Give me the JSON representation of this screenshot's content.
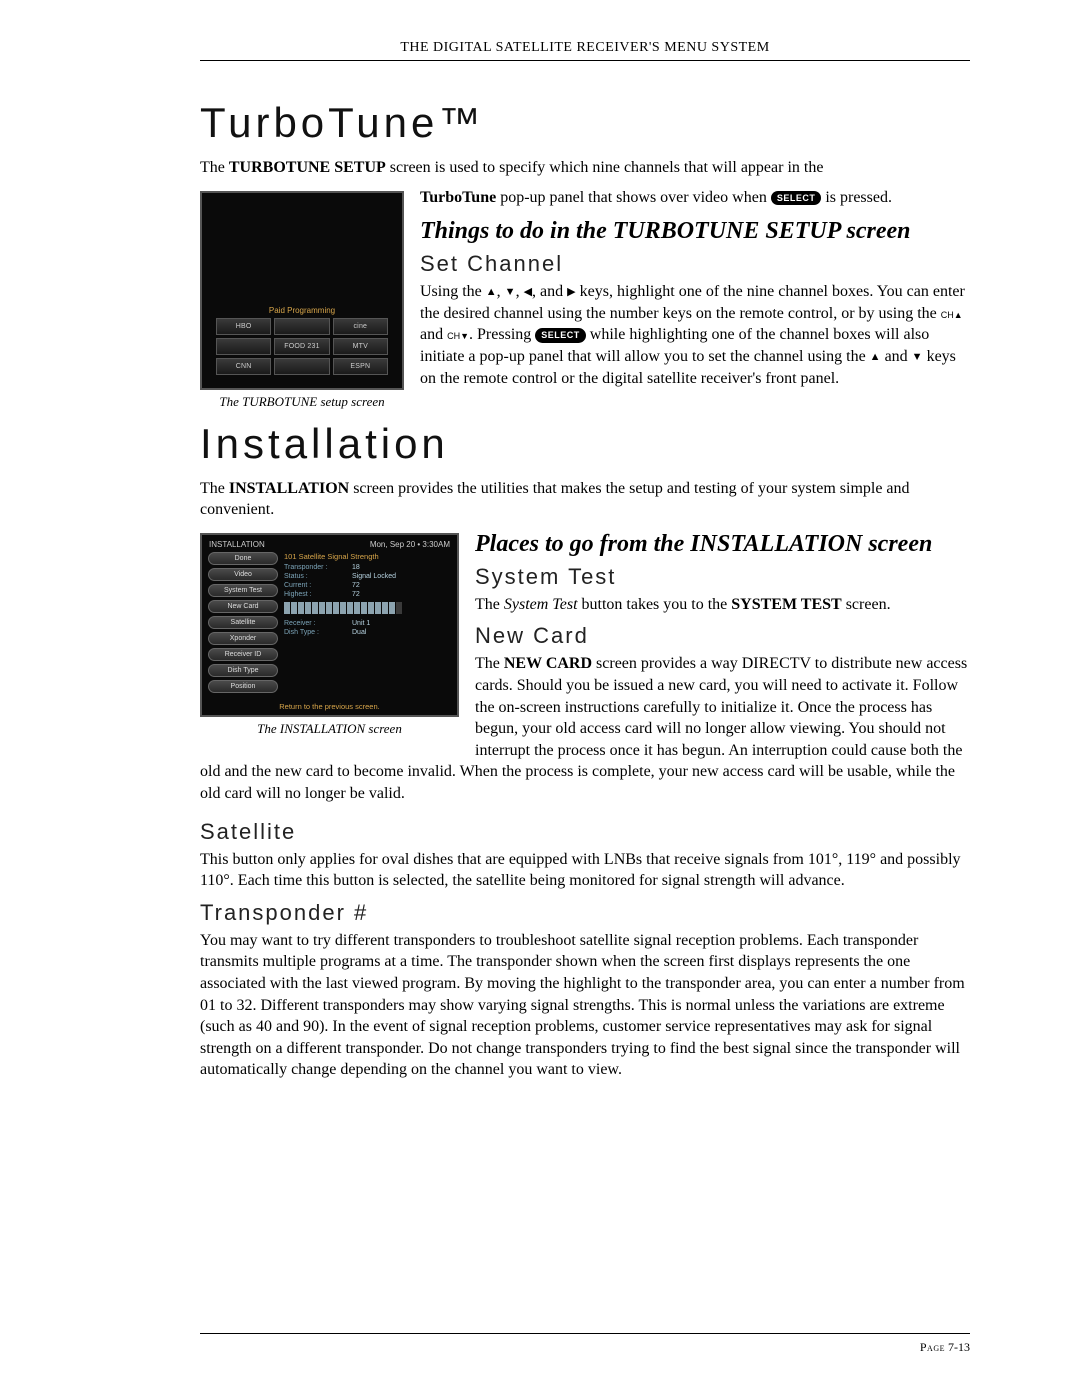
{
  "header": "THE DIGITAL SATELLITE RECEIVER'S MENU SYSTEM",
  "turbo": {
    "title": "TurboTune™",
    "intro_pre": "The ",
    "intro_bold1": "TURBOTUNE SETUP",
    "intro_mid": " screen is used to specify which nine channels that will appear in the ",
    "intro_bold2": "TurboTune",
    "intro_post1": " pop-up panel that shows over video when ",
    "select_label": "SELECT",
    "intro_post2": " is pressed.",
    "sub_h": "Things to do in the TURBOTUNE SETUP screen",
    "setch_h": "Set Channel",
    "setch_p1a": "Using the ",
    "setch_p1b": " keys, highlight one of the nine channel boxes. You can enter the desired channel using the number keys on the remote control, or by using the ",
    "setch_p1c": ". Pressing ",
    "setch_p1d": " while highlighting one of the channel boxes will also initiate a pop-up panel that will allow you to set the channel using the ",
    "setch_p1e": " keys on the remote control or the digital satellite receiver's front panel.",
    "and_word": " and ",
    "comma": ", ",
    "and_list": ", and ",
    "fig": {
      "caption": "The TURBOTUNE setup screen",
      "grid_title": "Paid Programming",
      "cells": [
        "HBO",
        "",
        "cine",
        "",
        "FOOD 231",
        "MTV",
        "CNN",
        "",
        "ESPN"
      ]
    }
  },
  "install": {
    "title": "Installation",
    "intro_pre": "The ",
    "intro_bold": "INSTALLATION",
    "intro_post": " screen provides the utilities that makes the setup and testing of your system simple and convenient.",
    "sub_h": "Places to go from the INSTALLATION screen",
    "systest_h": "System Test",
    "systest_p_pre": "The ",
    "systest_p_it": "System Test",
    "systest_p_mid": " button takes you to the ",
    "systest_p_bold": "SYSTEM TEST",
    "systest_p_post": " screen.",
    "newcard_h": "New Card",
    "newcard_p_pre": "The ",
    "newcard_p_bold": "NEW CARD",
    "newcard_p_post": " screen provides a way DIRECTV to distribute new access cards. Should you be issued a new card, you will need to activate it. Follow the on-screen instructions carefully to initialize it. Once the process has begun, your old access card will no longer allow viewing. You should not interrupt the process once it has begun. An interruption could cause both the old and the new card to become invalid. When the process is complete, your new access card will be usable, while the old card will no longer be valid.",
    "sat_h": "Satellite",
    "sat_p": "This button only applies for oval dishes that are equipped with LNBs that receive signals from 101°, 119° and possibly 110°. Each time this button is selected, the satellite being monitored for signal strength will advance.",
    "xp_h": "Transponder #",
    "xp_p": "You may want to try different transponders to troubleshoot satellite signal reception problems. Each transponder transmits multiple programs at a time. The transponder shown when the screen first displays represents the one associated with the last viewed program. By moving the highlight to the transponder area, you can enter a number from 01 to 32. Different transponders may show varying signal strengths. This is normal unless the variations are extreme (such as 40 and 90). In the event of signal reception problems, customer service representatives may ask for signal strength on a different transponder. Do not change transponders trying to find the best signal since the transponder will automatically change depending on the channel you want to view.",
    "fig": {
      "caption": "The INSTALLATION screen",
      "topbar_left": "INSTALLATION",
      "topbar_right": "Mon, Sep 20 • 3:30AM",
      "side_buttons": [
        "Done",
        "Video",
        "System Test",
        "New Card",
        "Satellite",
        "Xponder",
        "Receiver ID",
        "Dish Type",
        "Position"
      ],
      "panel_title": "101 Satellite Signal Strength",
      "kv": [
        {
          "k": "Transponder :",
          "v": "18"
        },
        {
          "k": "Status :",
          "v": "Signal Locked"
        },
        {
          "k": "Current :",
          "v": "72"
        },
        {
          "k": "Highest :",
          "v": "72"
        }
      ],
      "kv2": [
        {
          "k": "Receiver :",
          "v": "Unit 1"
        },
        {
          "k": "Dish Type :",
          "v": "Dual"
        }
      ],
      "footer": "Return to the previous screen."
    }
  },
  "footer": {
    "label": "Page",
    "num": "7-13"
  },
  "glyphs": {
    "up": "▲",
    "down": "▼",
    "left": "◀",
    "right": "▶",
    "ch_up": "CH▲",
    "ch_down": "CH▼"
  }
}
